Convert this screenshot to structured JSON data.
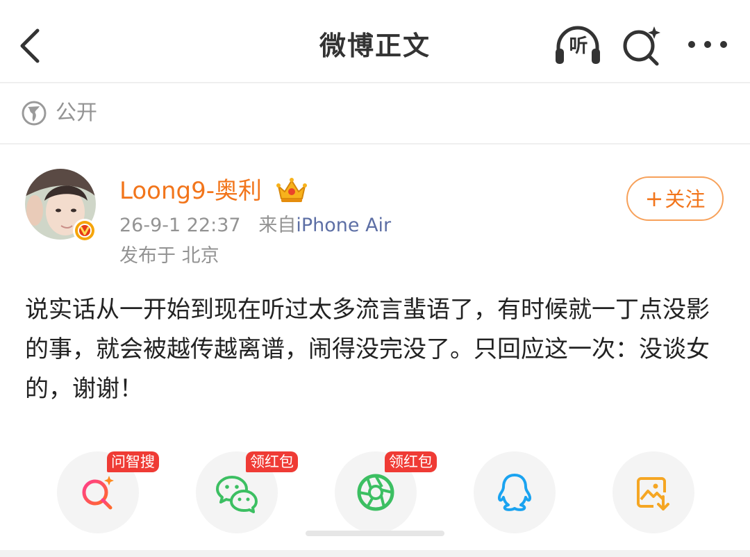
{
  "header": {
    "title": "微博正文",
    "back_icon": "chevron-left-icon",
    "listen_label": "听",
    "listen_icon": "headphones-icon",
    "search_icon": "ai-search-icon",
    "more_icon": "more-dots-icon"
  },
  "visibility": {
    "icon": "globe-icon",
    "label": "公开"
  },
  "post": {
    "username": "Loong9-奥利",
    "verified_icon": "verified-v-icon",
    "crown_icon": "crown-badge-icon",
    "time": "26-9-1 22:37",
    "source_prefix": "来自",
    "source": "iPhone Air",
    "location": "发布于 北京",
    "follow_label": "关注",
    "follow_plus": "+",
    "text": "说实话从一开始到现在听过太多流言蜚语了，有时候就一丁点没影的事，就会被越传越离谱，闹得没完没了。只回应这一次：没谈女的，谢谢！"
  },
  "share": [
    {
      "id": "zhisou",
      "icon": "ai-search-icon",
      "badge": "问智搜",
      "color": "#ef3b5a"
    },
    {
      "id": "wechat",
      "icon": "wechat-icon",
      "badge": "领红包",
      "color": "#3cbf62"
    },
    {
      "id": "moments",
      "icon": "wechat-moments-icon",
      "badge": "领红包",
      "color": "#3cbf62"
    },
    {
      "id": "qq",
      "icon": "qq-icon",
      "badge": "",
      "color": "#1aa3f0"
    },
    {
      "id": "save",
      "icon": "save-image-icon",
      "badge": "",
      "color": "#f5a623"
    }
  ],
  "colors": {
    "accent": "#f2751b",
    "meta": "#939393",
    "source_link": "#5d6fa5",
    "badge_red": "#ef3b35"
  }
}
